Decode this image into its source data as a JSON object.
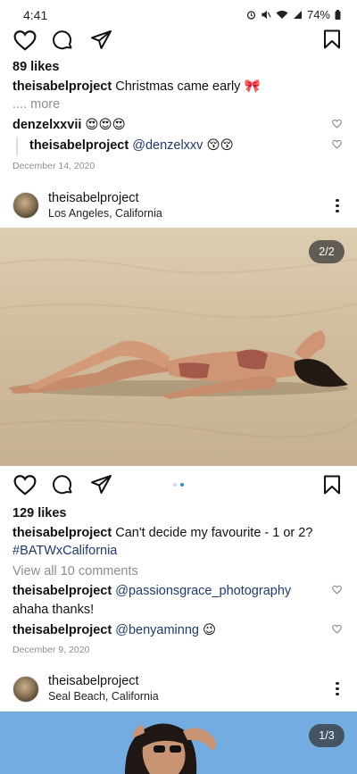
{
  "status_bar": {
    "time": "4:41",
    "battery": "74%"
  },
  "post1": {
    "likes": "89 likes",
    "caption_user": "theisabelproject",
    "caption_text": "Christmas came early 🎀",
    "more": ".... more",
    "comments": [
      {
        "user": "denzelxxvii",
        "text": "😍😍😍"
      },
      {
        "user": "theisabelproject",
        "mention": "@denzelxxv",
        "text": "😚😚"
      }
    ],
    "date": "December 14, 2020"
  },
  "post2": {
    "user": "theisabelproject",
    "location": "Los Angeles, California",
    "photo_counter": "2/2",
    "likes": "129 likes",
    "caption_user": "theisabelproject",
    "caption_text": "Can't decide my favourite - 1 or 2?",
    "hashtag": "#BATWxCalifornia",
    "view_comments": "View all 10 comments",
    "comments": [
      {
        "user": "theisabelproject",
        "mention": "@passionsgrace_photography",
        "text": "ahaha thanks!"
      },
      {
        "user": "theisabelproject",
        "mention": "@benyaminng",
        "text": "😉"
      }
    ],
    "date": "December 9, 2020"
  },
  "post3": {
    "user": "theisabelproject",
    "location": "Seal Beach, California",
    "photo_counter": "1/3"
  },
  "icons": [
    "heart-icon",
    "comment-icon",
    "share-icon",
    "bookmark-icon",
    "more-icon"
  ]
}
